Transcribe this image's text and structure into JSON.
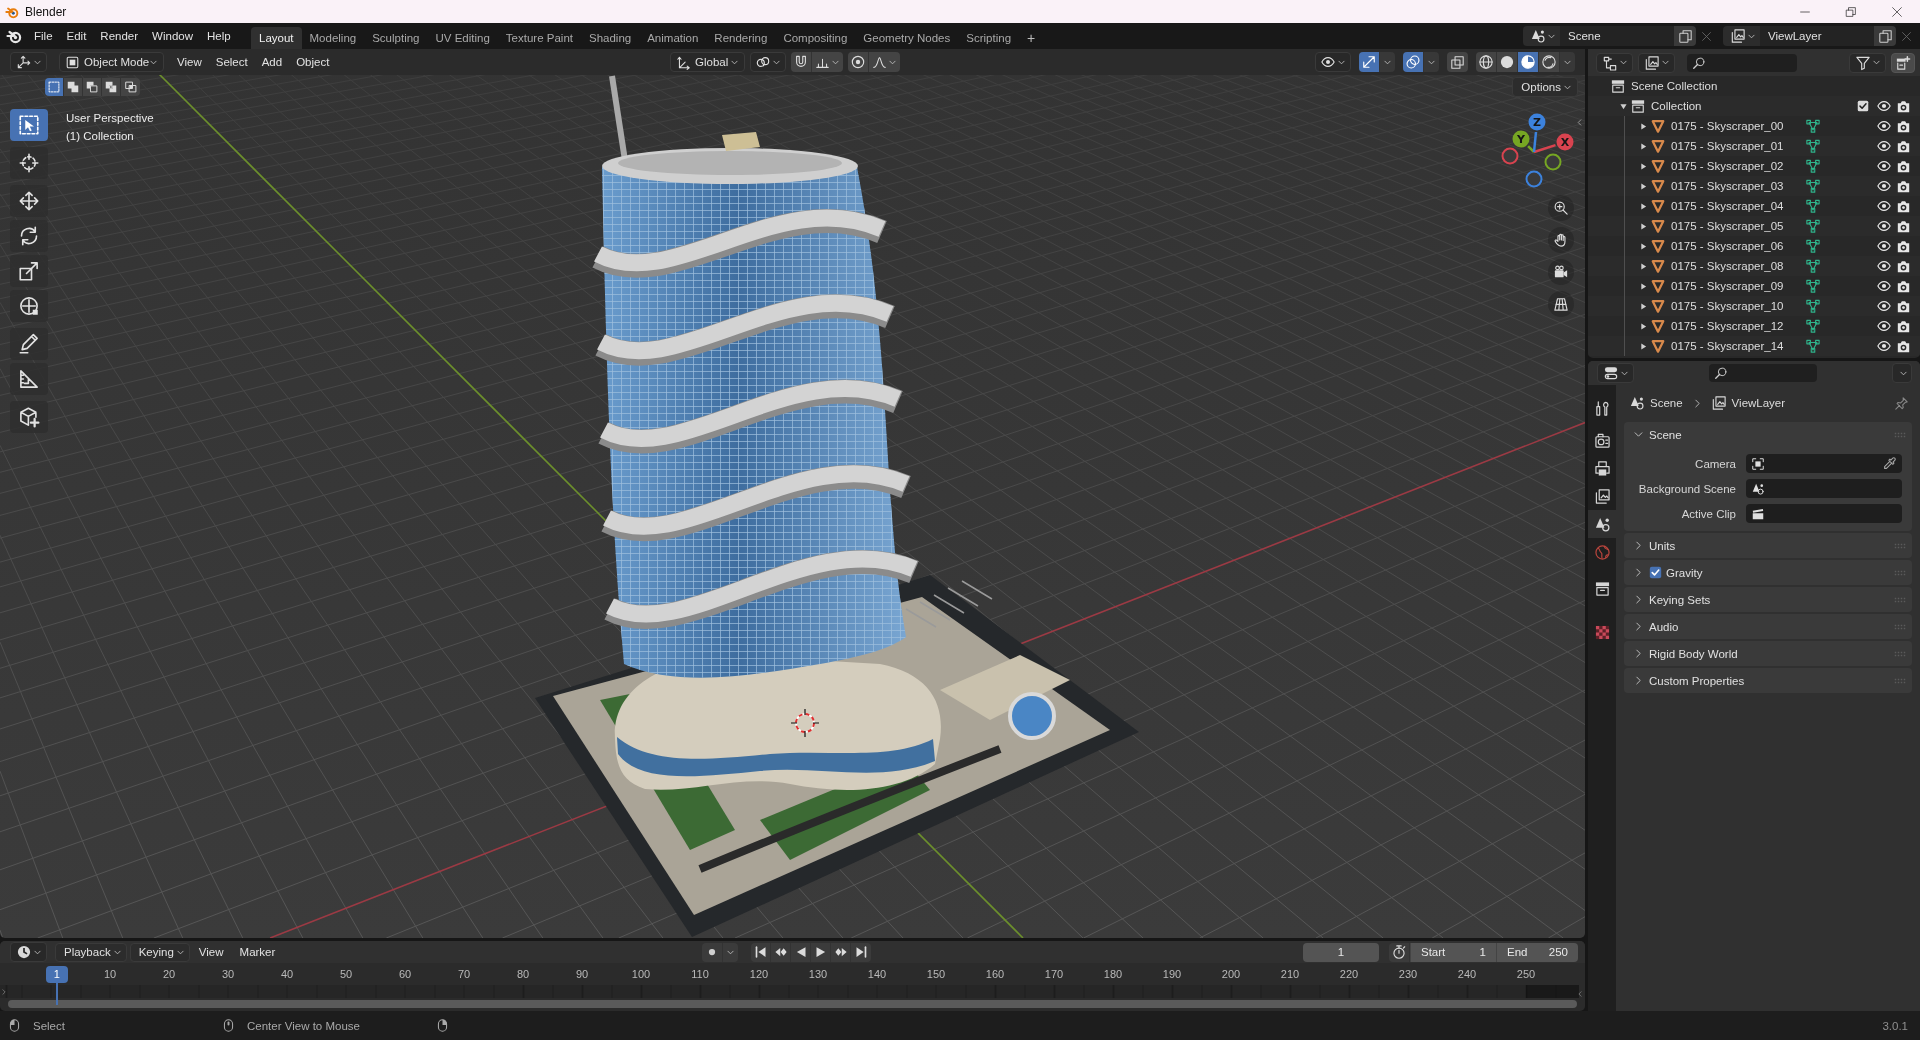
{
  "window": {
    "title": "Blender"
  },
  "top_bar": {
    "menus": [
      "File",
      "Edit",
      "Render",
      "Window",
      "Help"
    ],
    "workspace_tabs": [
      {
        "label": "Layout",
        "selected": true
      },
      {
        "label": "Modeling",
        "selected": false
      },
      {
        "label": "Sculpting",
        "selected": false
      },
      {
        "label": "UV Editing",
        "selected": false
      },
      {
        "label": "Texture Paint",
        "selected": false
      },
      {
        "label": "Shading",
        "selected": false
      },
      {
        "label": "Animation",
        "selected": false
      },
      {
        "label": "Rendering",
        "selected": false
      },
      {
        "label": "Compositing",
        "selected": false
      },
      {
        "label": "Geometry Nodes",
        "selected": false
      },
      {
        "label": "Scripting",
        "selected": false
      }
    ],
    "add_tab": "+",
    "scene": "Scene",
    "view_layer": "ViewLayer"
  },
  "viewport": {
    "mode": "Object Mode",
    "menus": [
      "View",
      "Select",
      "Add",
      "Object"
    ],
    "orientation": "Global",
    "gizmos_on": true,
    "overlays_on": true,
    "xray_on": false,
    "shading": [
      {
        "kind": "wireframe",
        "selected": false
      },
      {
        "kind": "solid",
        "selected": false
      },
      {
        "kind": "material",
        "selected": true
      },
      {
        "kind": "rendered",
        "selected": false
      }
    ],
    "select_modes": [
      {
        "kind": "set",
        "selected": true
      },
      {
        "kind": "extend",
        "selected": false
      },
      {
        "kind": "subtract",
        "selected": false
      },
      {
        "kind": "invert",
        "selected": false
      },
      {
        "kind": "intersect",
        "selected": false
      }
    ],
    "options": "Options",
    "tool_groups": [
      {
        "tools": [
          {
            "kind": "select_box",
            "selected": true
          }
        ]
      },
      {
        "tools": [
          {
            "kind": "cursor",
            "selected": false
          }
        ]
      },
      {
        "tools": [
          {
            "kind": "move",
            "selected": false
          },
          {
            "kind": "rotate",
            "selected": false
          },
          {
            "kind": "scale",
            "selected": false
          },
          {
            "kind": "transform",
            "selected": false
          }
        ]
      },
      {
        "tools": [
          {
            "kind": "annotate",
            "selected": false
          },
          {
            "kind": "measure",
            "selected": false
          }
        ]
      },
      {
        "tools": [
          {
            "kind": "add_cube",
            "selected": false
          }
        ]
      }
    ],
    "info": [
      "User Perspective",
      "(1) Collection"
    ],
    "axes": [
      {
        "label": "X",
        "color": "#d8434f"
      },
      {
        "label": "Y",
        "color": "#76a623"
      },
      {
        "label": "Z",
        "color": "#3c82dd"
      }
    ]
  },
  "outliner": {
    "tree": [
      {
        "label": "Scene Collection",
        "kind": "scene_collection",
        "children": [
          {
            "label": "Collection",
            "kind": "collection",
            "expanded": true,
            "checked": true,
            "visible": true,
            "children": [
              {
                "label": "0175 - Skyscraper_00",
                "kind": "object",
                "expanded": false,
                "visible": true
              },
              {
                "label": "0175 - Skyscraper_01",
                "kind": "object",
                "expanded": false,
                "visible": true
              },
              {
                "label": "0175 - Skyscraper_02",
                "kind": "object",
                "expanded": false,
                "visible": true
              },
              {
                "label": "0175 - Skyscraper_03",
                "kind": "object",
                "expanded": false,
                "visible": true
              },
              {
                "label": "0175 - Skyscraper_04",
                "kind": "object",
                "expanded": false,
                "visible": true
              },
              {
                "label": "0175 - Skyscraper_05",
                "kind": "object",
                "expanded": false,
                "visible": true
              },
              {
                "label": "0175 - Skyscraper_06",
                "kind": "object",
                "expanded": false,
                "visible": true
              },
              {
                "label": "0175 - Skyscraper_08",
                "kind": "object",
                "expanded": false,
                "visible": true
              },
              {
                "label": "0175 - Skyscraper_09",
                "kind": "object",
                "expanded": false,
                "visible": true
              },
              {
                "label": "0175 - Skyscraper_10",
                "kind": "object",
                "expanded": false,
                "visible": true
              },
              {
                "label": "0175 - Skyscraper_12",
                "kind": "object",
                "expanded": false,
                "visible": true
              },
              {
                "label": "0175 - Skyscraper_14",
                "kind": "object",
                "expanded": false,
                "visible": true
              }
            ]
          }
        ]
      }
    ]
  },
  "properties": {
    "tabs": [
      {
        "kind": "tool",
        "selected": false
      },
      {
        "kind": "render",
        "selected": false
      },
      {
        "kind": "output",
        "selected": false
      },
      {
        "kind": "view_layer",
        "selected": false
      },
      {
        "kind": "scene",
        "selected": true
      },
      {
        "kind": "world",
        "selected": false
      },
      {
        "kind": "collection",
        "selected": false
      },
      {
        "kind": "texture",
        "selected": false
      }
    ],
    "breadcrumb": [
      {
        "kind": "scene",
        "label": "Scene"
      },
      {
        "kind": "view_layer",
        "label": "ViewLayer"
      }
    ],
    "panels": [
      {
        "title": "Scene",
        "expanded": true,
        "fields": [
          {
            "kind": "object",
            "label": "Camera"
          },
          {
            "kind": "scene",
            "label": "Background Scene"
          },
          {
            "kind": "clip",
            "label": "Active Clip"
          }
        ]
      },
      {
        "title": "Units",
        "expanded": false
      },
      {
        "title": "Gravity",
        "expanded": false,
        "header_checkbox": {
          "checked": true
        }
      },
      {
        "title": "Keying Sets",
        "expanded": false
      },
      {
        "title": "Audio",
        "expanded": false
      },
      {
        "title": "Rigid Body World",
        "expanded": false
      },
      {
        "title": "Custom Properties",
        "expanded": false
      }
    ]
  },
  "timeline": {
    "menus": [
      {
        "label": "Playback",
        "kind": "dropdown"
      },
      {
        "label": "Keying",
        "kind": "dropdown"
      },
      {
        "label": "View",
        "kind": "menu"
      },
      {
        "label": "Marker",
        "kind": "menu"
      }
    ],
    "auto_keying": false,
    "current_frame": "1",
    "start": {
      "label": "Start",
      "value": "1"
    },
    "end": {
      "label": "End",
      "value": "250"
    },
    "ruler": [
      "10",
      "20",
      "30",
      "40",
      "50",
      "60",
      "70",
      "80",
      "90",
      "100",
      "110",
      "120",
      "130",
      "140",
      "150",
      "160",
      "170",
      "180",
      "190",
      "200",
      "210",
      "220",
      "230",
      "240",
      "250"
    ],
    "playhead": "1"
  },
  "status_bar": {
    "hints": [
      {
        "kind": "left_click",
        "label": "Select"
      },
      {
        "kind": "middle_click",
        "label": "Center View to Mouse"
      },
      {
        "kind": "right_click"
      }
    ],
    "version": "3.0.1"
  }
}
